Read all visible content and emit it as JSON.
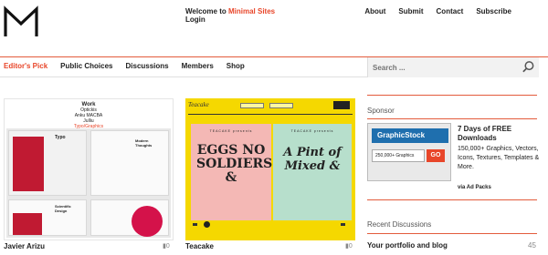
{
  "header": {
    "welcome_prefix": "Welcome to ",
    "brand": "Minimal Sites",
    "login": "Login",
    "top_nav": [
      "About",
      "Submit",
      "Contact",
      "Subscribe"
    ]
  },
  "main_nav": {
    "items": [
      "Editor's Pick",
      "Public Choices",
      "Discussions",
      "Members",
      "Shop"
    ],
    "active": "Editor's Pick"
  },
  "search": {
    "placeholder": "Search ..."
  },
  "sites": [
    {
      "name": "Javier Arizu",
      "comments": "0",
      "thumb_lines": [
        "Work",
        "Optickis",
        "Anku MACBA",
        "Julliu",
        "Typo/Graphics"
      ],
      "thumb_pages": [
        "Typo",
        "Modern Thoughts",
        "Scientific Design"
      ]
    },
    {
      "name": "Teacake",
      "comments": "0",
      "thumb_logo": "Teacake",
      "thumb_left_title": "EGGS NO SOLDIERS &",
      "thumb_right_title": "A Pint of Mixed &",
      "thumb_credit": "TEACAKE presents"
    }
  ],
  "sidebar": {
    "sponsor_heading": "Sponsor",
    "ad": {
      "brand": "GraphicStock",
      "badge_text": "250,000+ Graphics",
      "badge_button": "GO",
      "title": "7 Days of FREE Downloads",
      "description": "150,000+ Graphics, Vectors, Icons, Textures, Templates & More.",
      "via": "via Ad Packs"
    },
    "recent_heading": "Recent Discussions",
    "discussions": [
      {
        "title": "Your portfolio and blog",
        "count": "45"
      }
    ]
  },
  "colors": {
    "accent": "#e8462a",
    "ad_blue": "#1f6fae",
    "yellow": "#f5d800"
  }
}
